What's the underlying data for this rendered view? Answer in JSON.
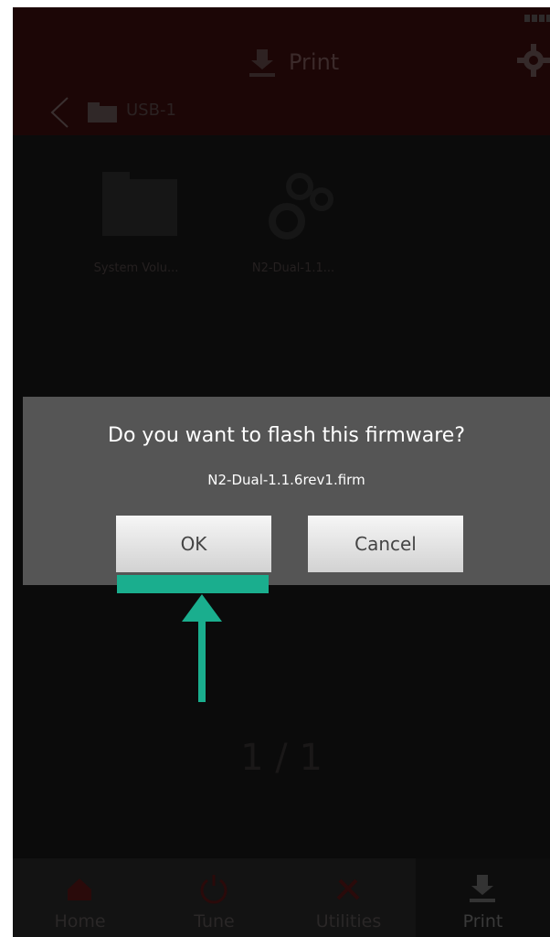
{
  "header": {
    "title": "Print",
    "breadcrumb_label": "USB-1",
    "icons": [
      "print-icon",
      "gear-icon",
      "back-icon",
      "folder-icon",
      "battery-icon"
    ]
  },
  "files": [
    {
      "label": "System Volu...",
      "icon": "folder-icon"
    },
    {
      "label": "N2-Dual-1.1...",
      "icon": "gears-icon"
    }
  ],
  "page_indicator": "1 / 1",
  "nav": [
    {
      "label": "Home",
      "icon": "home-icon"
    },
    {
      "label": "Tune",
      "icon": "tune-icon"
    },
    {
      "label": "Utilities",
      "icon": "utilities-icon"
    },
    {
      "label": "Print",
      "icon": "print-icon"
    }
  ],
  "dialog": {
    "title": "Do you want to flash this firmware?",
    "filename": "N2-Dual-1.1.6rev1.firm",
    "ok_label": "OK",
    "cancel_label": "Cancel"
  },
  "colors": {
    "accent_annotation": "#1aae8e",
    "dialog_bg": "#555555",
    "header_bg": "#1c0606",
    "screen_bg": "#0b0b0b"
  }
}
